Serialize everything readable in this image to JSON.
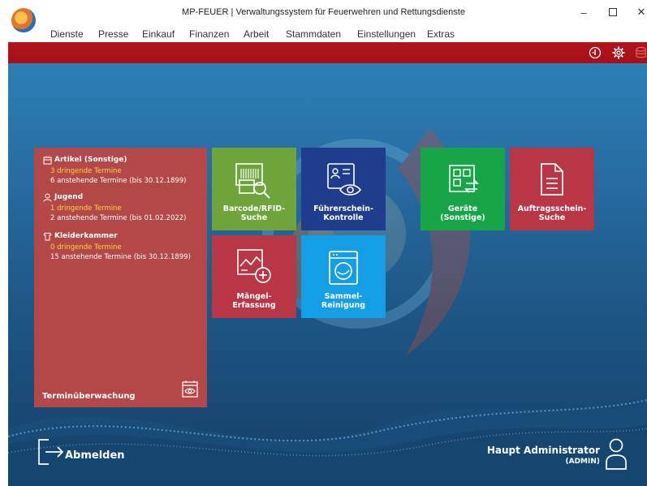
{
  "window": {
    "title": "MP-FEUER | Verwaltungssystem für Feuerwehren und Rettungsdienste",
    "minimize": "–",
    "close": "✕"
  },
  "menu": [
    "Dienste",
    "Presse",
    "Einkauf",
    "Finanzen",
    "Arbeit",
    "Stammdaten",
    "Einstellungen",
    "Extras"
  ],
  "toolbar": {
    "icons": [
      "info-icon",
      "gear-icon",
      "database-icon"
    ]
  },
  "appointments": {
    "footer": "Terminüberwachung",
    "sections": [
      {
        "title": "Artikel (Sonstige)",
        "urgent": "3 dringende Termine",
        "pending": "6 anstehende Termine (bis 30.12.1899)"
      },
      {
        "title": "Jugend",
        "urgent": "1 dringende Termine",
        "pending": "2 anstehende Termine (bis 01.02.2022)"
      },
      {
        "title": "Kleiderkammer",
        "urgent": "0 dringende Termine",
        "pending": "15 anstehende Termine (bis 30.12.1899)"
      }
    ]
  },
  "tiles": {
    "barcode": {
      "line1": "Barcode/RFID-",
      "line2": "Suche",
      "color": "#6ea43a"
    },
    "fuehrerschein": {
      "line1": "Führerschein-",
      "line2": "Kontrolle",
      "color": "#1f3d8c"
    },
    "geraete": {
      "line1": "Geräte",
      "line2": "(Sonstige)",
      "color": "#18a548"
    },
    "auftrag": {
      "line1": "Auftragsschein-",
      "line2": "Suche",
      "color": "#b83645"
    },
    "maengel": {
      "line1": "Mängel-",
      "line2": "Erfassung",
      "color": "#b83645"
    },
    "sammel": {
      "line1": "Sammel-",
      "line2": "Reinigung",
      "color": "#139ee6"
    }
  },
  "footer": {
    "logout": "Abmelden",
    "user_name": "Haupt Administrator",
    "user_role": "(ADMIN)"
  },
  "colors": {
    "accent_red": "#b3141c",
    "urgent_yellow": "#ffd53b",
    "background_blue": "#266aa0"
  }
}
